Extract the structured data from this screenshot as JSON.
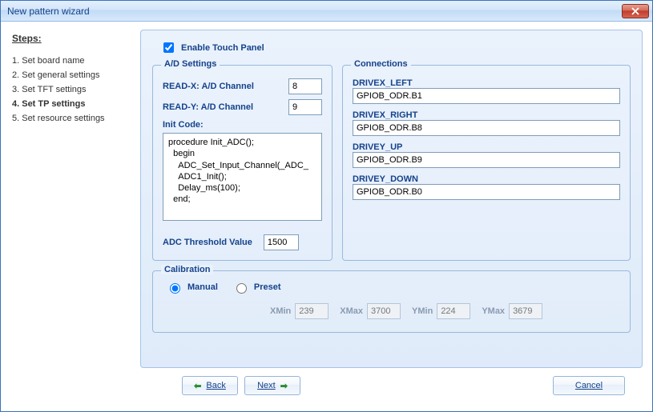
{
  "window": {
    "title": "New pattern wizard"
  },
  "sidebar": {
    "title": "Steps:",
    "items": [
      {
        "label": "1. Set board name",
        "active": false
      },
      {
        "label": "2. Set general settings",
        "active": false
      },
      {
        "label": "3. Set TFT settings",
        "active": false
      },
      {
        "label": "4. Set TP settings",
        "active": true
      },
      {
        "label": "5. Set resource settings",
        "active": false
      }
    ]
  },
  "enable_label": "Enable Touch Panel",
  "enable_checked": true,
  "ad": {
    "legend": "A/D Settings",
    "readx_label": "READ-X: A/D Channel",
    "readx_value": "8",
    "ready_label": "READ-Y: A/D Channel",
    "ready_value": "9",
    "init_label": "Init Code:",
    "init_code": "procedure Init_ADC();\n  begin\n    ADC_Set_Input_Channel(_ADC_\n    ADC1_Init();\n    Delay_ms(100);\n  end;",
    "threshold_label": "ADC Threshold Value",
    "threshold_value": "1500"
  },
  "conn": {
    "legend": "Connections",
    "items": [
      {
        "label": "DRIVEX_LEFT",
        "value": "GPIOB_ODR.B1"
      },
      {
        "label": "DRIVEX_RIGHT",
        "value": "GPIOB_ODR.B8"
      },
      {
        "label": "DRIVEY_UP",
        "value": "GPIOB_ODR.B9"
      },
      {
        "label": "DRIVEY_DOWN",
        "value": "GPIOB_ODR.B0"
      }
    ]
  },
  "cal": {
    "legend": "Calibration",
    "manual_label": "Manual",
    "preset_label": "Preset",
    "selected": "manual",
    "xmin_label": "XMin",
    "xmin": "239",
    "xmax_label": "XMax",
    "xmax": "3700",
    "ymin_label": "YMin",
    "ymin": "224",
    "ymax_label": "YMax",
    "ymax": "3679"
  },
  "buttons": {
    "back": "Back",
    "next": "Next",
    "cancel": "Cancel"
  }
}
